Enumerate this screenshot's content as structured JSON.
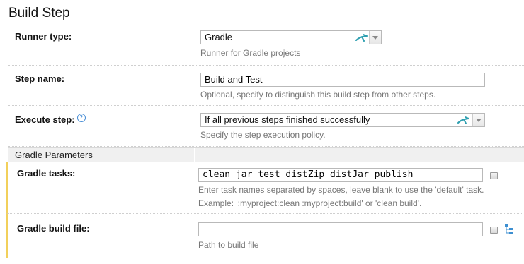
{
  "page": {
    "title": "Build Step"
  },
  "runner": {
    "label": "Runner type:",
    "value": "Gradle",
    "hint": "Runner for Gradle projects"
  },
  "step_name": {
    "label": "Step name:",
    "value": "Build and Test",
    "hint": "Optional, specify to distinguish this build step from other steps."
  },
  "execute": {
    "label": "Execute step:",
    "help_icon": "?",
    "value": "If all previous steps finished successfully",
    "hint": "Specify the step execution policy."
  },
  "section": {
    "label": "Gradle Parameters"
  },
  "tasks": {
    "label": "Gradle tasks:",
    "value": "clean jar test distZip distJar publish",
    "hint1": "Enter task names separated by spaces, leave blank to use the 'default' task.",
    "hint2": "Example: ':myproject:clean :myproject:build' or 'clean build'."
  },
  "build_file": {
    "label": "Gradle build file:",
    "value": "",
    "hint": "Path to build file"
  },
  "colors": {
    "accent_marker": "#f2d05b",
    "runner_icon": "#2e9fb0"
  },
  "icons": [
    "help-icon",
    "gradle-runner-icon",
    "chevron-down-icon",
    "expand-textarea-icon",
    "tree-browse-icon"
  ]
}
